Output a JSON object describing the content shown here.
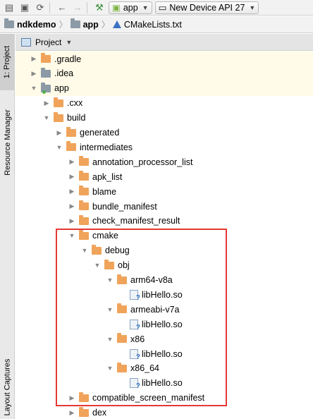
{
  "toolbar": {
    "run_config": "app",
    "device": "New Device API 27"
  },
  "breadcrumb": {
    "items": [
      "ndkdemo",
      "app",
      "CMakeLists.txt"
    ]
  },
  "side_tabs": {
    "project": "1: Project",
    "resource_manager": "Resource Manager",
    "layout_captures": "Layout Captures"
  },
  "panel": {
    "title": "Project"
  },
  "tree": [
    {
      "label": ".gradle",
      "depth": 1,
      "expanded": false,
      "kind": "folder"
    },
    {
      "label": ".idea",
      "depth": 1,
      "expanded": false,
      "kind": "folder-gray"
    },
    {
      "label": "app",
      "depth": 1,
      "expanded": true,
      "kind": "module"
    },
    {
      "label": ".cxx",
      "depth": 2,
      "expanded": false,
      "kind": "folder"
    },
    {
      "label": "build",
      "depth": 2,
      "expanded": true,
      "kind": "folder"
    },
    {
      "label": "generated",
      "depth": 3,
      "expanded": false,
      "kind": "folder"
    },
    {
      "label": "intermediates",
      "depth": 3,
      "expanded": true,
      "kind": "folder"
    },
    {
      "label": "annotation_processor_list",
      "depth": 4,
      "expanded": false,
      "kind": "folder"
    },
    {
      "label": "apk_list",
      "depth": 4,
      "expanded": false,
      "kind": "folder"
    },
    {
      "label": "blame",
      "depth": 4,
      "expanded": false,
      "kind": "folder"
    },
    {
      "label": "bundle_manifest",
      "depth": 4,
      "expanded": false,
      "kind": "folder"
    },
    {
      "label": "check_manifest_result",
      "depth": 4,
      "expanded": false,
      "kind": "folder"
    },
    {
      "label": "cmake",
      "depth": 4,
      "expanded": true,
      "kind": "folder"
    },
    {
      "label": "debug",
      "depth": 5,
      "expanded": true,
      "kind": "folder"
    },
    {
      "label": "obj",
      "depth": 6,
      "expanded": true,
      "kind": "folder"
    },
    {
      "label": "arm64-v8a",
      "depth": 7,
      "expanded": true,
      "kind": "folder"
    },
    {
      "label": "libHello.so",
      "depth": 8,
      "expanded": null,
      "kind": "file"
    },
    {
      "label": "armeabi-v7a",
      "depth": 7,
      "expanded": true,
      "kind": "folder"
    },
    {
      "label": "libHello.so",
      "depth": 8,
      "expanded": null,
      "kind": "file"
    },
    {
      "label": "x86",
      "depth": 7,
      "expanded": true,
      "kind": "folder"
    },
    {
      "label": "libHello.so",
      "depth": 8,
      "expanded": null,
      "kind": "file"
    },
    {
      "label": "x86_64",
      "depth": 7,
      "expanded": true,
      "kind": "folder"
    },
    {
      "label": "libHello.so",
      "depth": 8,
      "expanded": null,
      "kind": "file"
    },
    {
      "label": "compatible_screen_manifest",
      "depth": 4,
      "expanded": false,
      "kind": "folder"
    },
    {
      "label": "dex",
      "depth": 4,
      "expanded": false,
      "kind": "folder"
    }
  ]
}
